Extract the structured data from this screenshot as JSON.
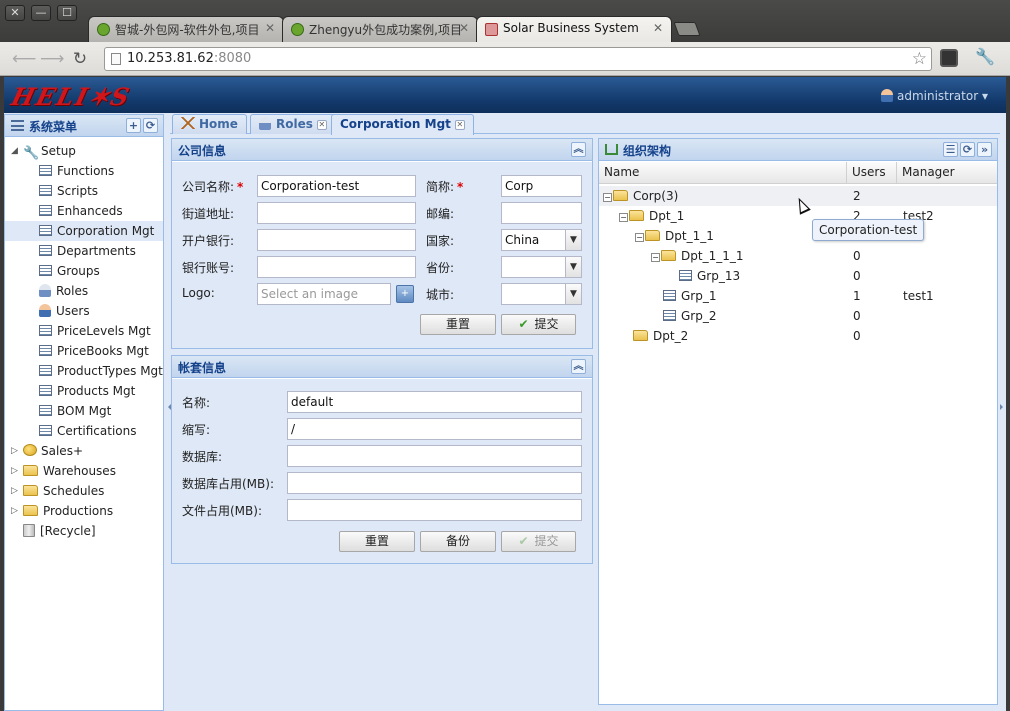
{
  "browser": {
    "window_buttons": [
      "✕",
      "—",
      "☐"
    ],
    "tabs": [
      {
        "label": "智城-外包网-软件外包,项目",
        "active": false
      },
      {
        "label": "Zhengyu外包成功案例,项目",
        "active": false
      },
      {
        "label": "Solar Business System",
        "active": true
      }
    ],
    "url_host": "10.253.81.62",
    "url_port": ":8080"
  },
  "app": {
    "logo": "HELI✶S",
    "user": "administrator"
  },
  "sidebar": {
    "title": "系统菜单",
    "items": [
      {
        "label": "Setup"
      },
      {
        "label": "Functions"
      },
      {
        "label": "Scripts"
      },
      {
        "label": "Enhanceds"
      },
      {
        "label": "Corporation Mgt"
      },
      {
        "label": "Departments"
      },
      {
        "label": "Groups"
      },
      {
        "label": "Roles"
      },
      {
        "label": "Users"
      },
      {
        "label": "PriceLevels Mgt"
      },
      {
        "label": "PriceBooks Mgt"
      },
      {
        "label": "ProductTypes Mgt"
      },
      {
        "label": "Products Mgt"
      },
      {
        "label": "BOM Mgt"
      },
      {
        "label": "Certifications"
      },
      {
        "label": "Sales+"
      },
      {
        "label": "Warehouses"
      },
      {
        "label": "Schedules"
      },
      {
        "label": "Productions"
      },
      {
        "label": "[Recycle]"
      }
    ]
  },
  "content_tabs": [
    {
      "label": "Home"
    },
    {
      "label": "Roles"
    },
    {
      "label": "Corporation Mgt"
    }
  ],
  "company_panel": {
    "title": "公司信息",
    "labels": {
      "name": "公司名称:",
      "short": "简称:",
      "street": "街道地址:",
      "zip": "邮编:",
      "bank": "开户银行:",
      "country": "国家:",
      "account": "银行账号:",
      "province": "省份:",
      "logo": "Logo:",
      "city": "城市:"
    },
    "values": {
      "name": "Corporation-test",
      "short": "Corp",
      "country": "China",
      "logo_placeholder": "Select an image"
    },
    "reset": "重置",
    "submit": "提交"
  },
  "account_panel": {
    "title": "帐套信息",
    "labels": {
      "name": "名称:",
      "abbr": "缩写:",
      "db": "数据库:",
      "db_usage": "数据库占用(MB):",
      "file_usage": "文件占用(MB):"
    },
    "values": {
      "name": "default",
      "abbr": "/"
    },
    "reset": "重置",
    "backup": "备份",
    "submit": "提交"
  },
  "org_panel": {
    "title": "组织架构",
    "columns": [
      "Name",
      "Users",
      "Manager"
    ],
    "rows": [
      {
        "name": "Corp(3)",
        "users": "2",
        "manager": ""
      },
      {
        "name": "Dpt_1",
        "users": "2",
        "manager": "test2"
      },
      {
        "name": "Dpt_1_1",
        "users": "",
        "manager": ""
      },
      {
        "name": "Dpt_1_1_1",
        "users": "0",
        "manager": ""
      },
      {
        "name": "Grp_13",
        "users": "0",
        "manager": ""
      },
      {
        "name": "Grp_1",
        "users": "1",
        "manager": "test1"
      },
      {
        "name": "Grp_2",
        "users": "0",
        "manager": ""
      },
      {
        "name": "Dpt_2",
        "users": "0",
        "manager": ""
      }
    ]
  },
  "tooltip": "Corporation-test"
}
